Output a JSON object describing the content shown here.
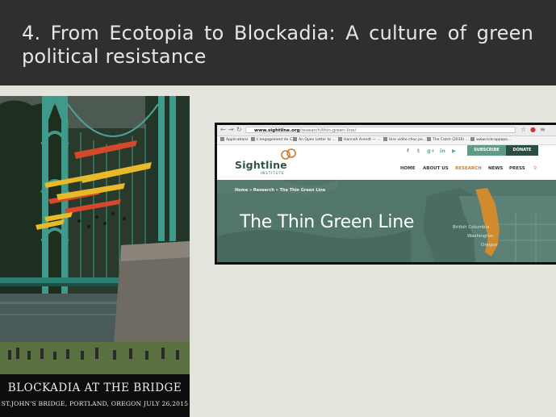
{
  "slide": {
    "title": "4. From Ecotopia to Blockadia: A culture of green political resistance"
  },
  "poster": {
    "headline": "BLOCKADIA AT THE BRIDGE",
    "caption": "ST.JOHN'S BRIDGE, PORTLAND, OREGON JULY 26,2015"
  },
  "browser": {
    "url_domain": "www.sightline.org",
    "url_path": "/research/thin-green-line/",
    "bookmarks": [
      "Applications",
      "L'engagement de C...",
      "An Open Letter to ...",
      "Hannah Arendt — ...",
      "Une vidéo choc po...",
      "The Catch (2016) ...",
      "www.rickrappapo..."
    ]
  },
  "site": {
    "logo": "Sightline",
    "logo_sub": "INSTITUTE",
    "social": [
      "f",
      "t",
      "g+",
      "in",
      "yt"
    ],
    "subscribe_label": "SUBSCRIBE",
    "donate_label": "DONATE",
    "menu": [
      "HOME",
      "ABOUT US",
      "RESEARCH",
      "NEWS",
      "PRESS"
    ],
    "breadcrumb": "Home  »  Research  »  The Thin Green Line",
    "hero_title": "The Thin Green Line",
    "map_labels": [
      "British Columbia",
      "Washington",
      "Oregon"
    ]
  },
  "colors": {
    "header_bg": "#2f2f2f",
    "slide_bg": "#e3e4dc",
    "sightline_green": "#5e9a84",
    "sightline_dark": "#2c4d41",
    "research_orange": "#c97b2e",
    "map_orange": "#d18a2e"
  }
}
